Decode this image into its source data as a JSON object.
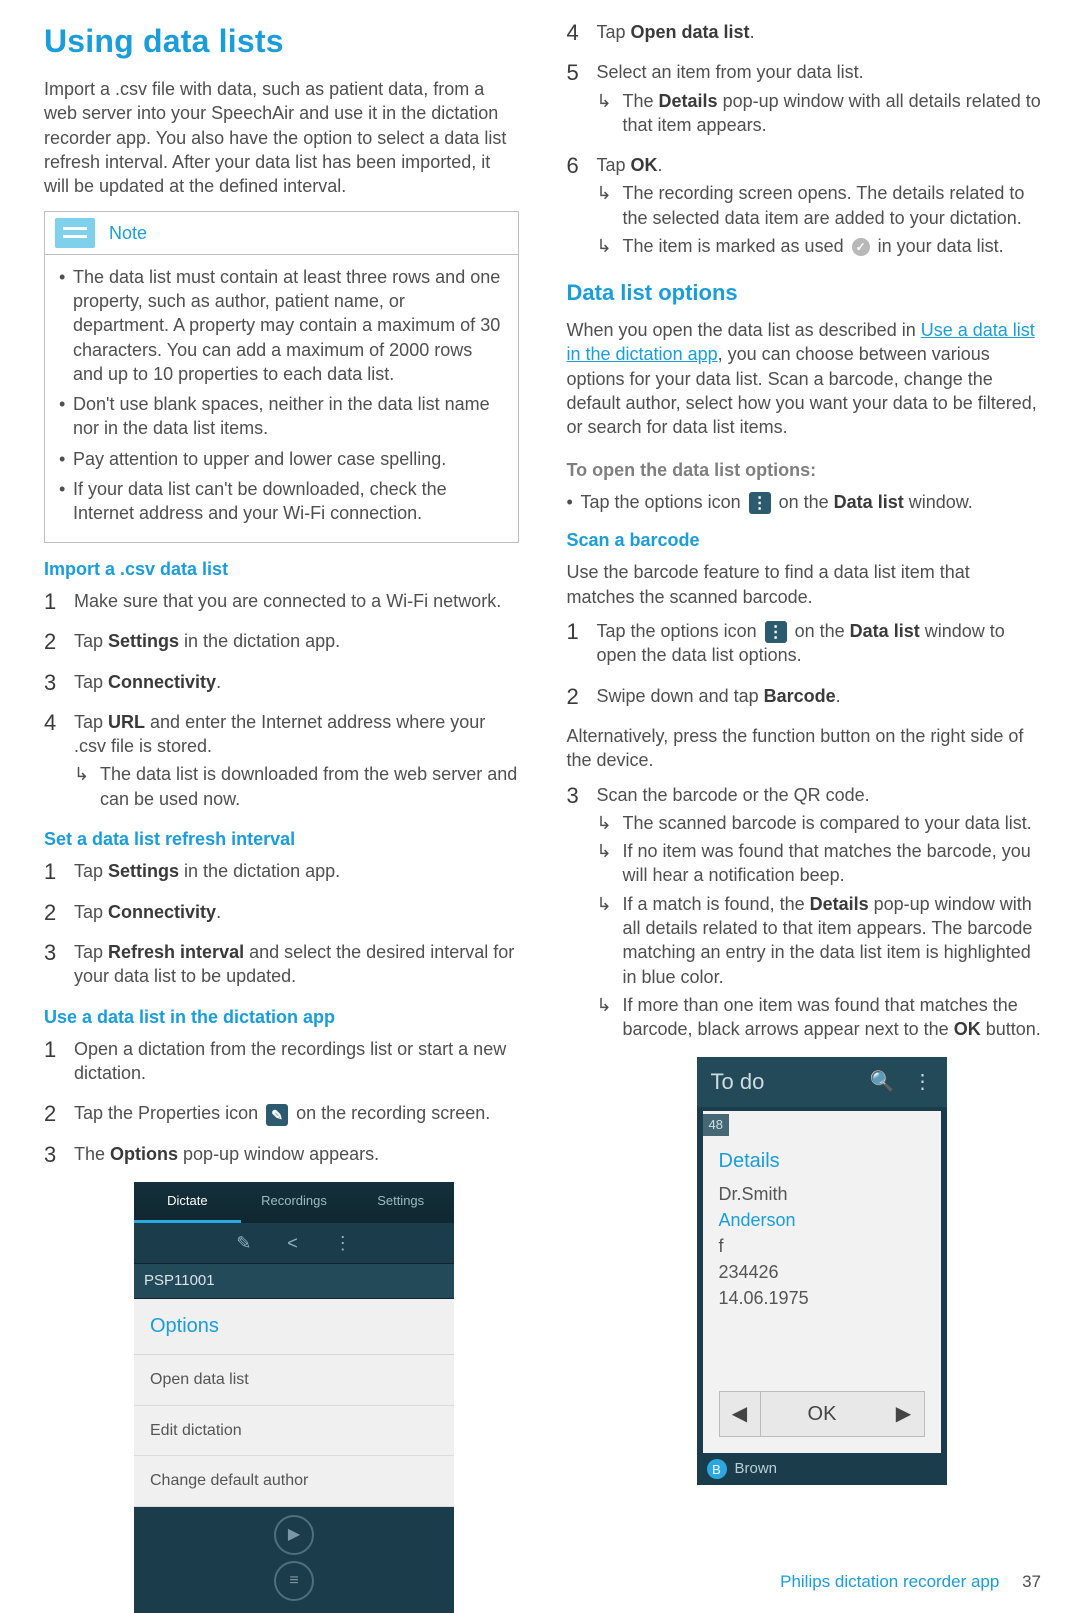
{
  "h1": "Using data lists",
  "intro": "Import a .csv file with data, such as patient data, from a web server into your SpeechAir and use it in the dictation recorder app.  You also have the option to select a data list refresh interval. After your data list has been imported, it will be updated at the defined interval.",
  "note": {
    "label": "Note",
    "items": [
      "The data list must contain at least three rows and one property, such as author, patient name, or department. A property may contain a maximum of 30 characters. You can add a maximum of 2000 rows and up to 10 properties to each data list.",
      "Don't use blank spaces, neither in the data list name nor in the data list items.",
      "Pay attention to upper and lower case spelling.",
      "If your data list can't be downloaded, check the Internet address and your Wi-Fi connection."
    ]
  },
  "sec_import_h": "Import a .csv data list",
  "import_steps": {
    "s1": "Make sure that you are connected to a Wi-Fi network.",
    "s2_a": "Tap ",
    "s2_b": "Settings",
    "s2_c": " in the dictation app.",
    "s3_a": "Tap ",
    "s3_b": "Connectivity",
    "s3_c": ".",
    "s4_a": "Tap ",
    "s4_b": "URL",
    "s4_c": " and enter the Internet address where your .csv file is stored.",
    "s4_r": "The data list is downloaded from the web server and can be used now."
  },
  "sec_refresh_h": "Set a data list refresh interval",
  "refresh_steps": {
    "s1_a": "Tap ",
    "s1_b": "Settings",
    "s1_c": " in the dictation app.",
    "s2_a": "Tap ",
    "s2_b": "Connectivity",
    "s2_c": ".",
    "s3_a": "Tap ",
    "s3_b": "Refresh interval",
    "s3_c": " and select the desired interval for your data list to be updated."
  },
  "sec_use_h": "Use a data list in the dictation app",
  "use_steps": {
    "s1": "Open a dictation from the recordings list or start a new dictation.",
    "s2_a": "Tap the Properties icon ",
    "s2_b": " on the recording screen.",
    "s3_a": "The ",
    "s3_b": "Options",
    "s3_c": " pop-up window appears."
  },
  "right_steps": {
    "s4_a": "Tap ",
    "s4_b": "Open data list",
    "s4_c": ".",
    "s5": "Select an item from your data list.",
    "s5_r_a": "The ",
    "s5_r_b": "Details",
    "s5_r_c": " pop-up window with all details related to that item appears.",
    "s6_a": "Tap ",
    "s6_b": "OK",
    "s6_c": ".",
    "s6_r1": "The recording screen opens. The details related to the selected data item are added to your dictation.",
    "s6_r2_a": "The item is marked as used ",
    "s6_r2_b": " in your data list."
  },
  "sec_options_h": "Data list options",
  "options_p_a": "When you open the data list as described in ",
  "options_link": "Use a data list in the dictation app",
  "options_p_b": ", you can choose between various options for your data list. Scan a barcode, change the default author, select how you want your data to be filtered, or search for data list items.",
  "open_opts_h": "To open the data list options:",
  "open_opts_a": "Tap the options icon ",
  "open_opts_b_a": " on the ",
  "open_opts_b_b": "Data list",
  "open_opts_b_c": " window.",
  "sec_scan_h": "Scan a barcode",
  "scan_p": "Use the barcode feature to find a data list item that matches the scanned barcode.",
  "scan_steps": {
    "s1_a": "Tap the options icon ",
    "s1_b_a": " on the ",
    "s1_b_b": "Data list",
    "s1_b_c": " window to open the data list options.",
    "s2_a": "Swipe down and tap ",
    "s2_b": "Barcode",
    "s2_c": "."
  },
  "scan_alt": "Alternatively, press the function button on the right side of the device.",
  "scan_steps3": {
    "s3": "Scan the barcode or the QR code.",
    "r1": "The scanned barcode is compared to your data list.",
    "r2": "If no item was found that matches the barcode, you will hear a notification beep.",
    "r3_a": "If a match is found, the ",
    "r3_b": "Details",
    "r3_c": " pop-up window with all details related to that item appears. The barcode matching an entry in the data list item is highlighted in blue color.",
    "r4_a": "If more than one item was found that matches the barcode, black arrows appear next to the ",
    "r4_b": "OK",
    "r4_c": " button."
  },
  "shot1": {
    "tabs": [
      "Dictate",
      "Recordings",
      "Settings"
    ],
    "tools": [
      "✎",
      "<",
      "⋮"
    ],
    "sub": "PSP11001",
    "modal_h": "Options",
    "opts": [
      "Open data list",
      "Edit dictation",
      "Change default author"
    ],
    "b1": "▶",
    "b2": "≡"
  },
  "shot2": {
    "head": "To do",
    "title": "Details",
    "rows": [
      "Dr.Smith",
      "Anderson",
      "f",
      "234426",
      "14.06.1975"
    ],
    "ok": "OK",
    "foot": "Brown"
  },
  "footer": {
    "title": "Philips dictation recorder app",
    "page": "37"
  }
}
